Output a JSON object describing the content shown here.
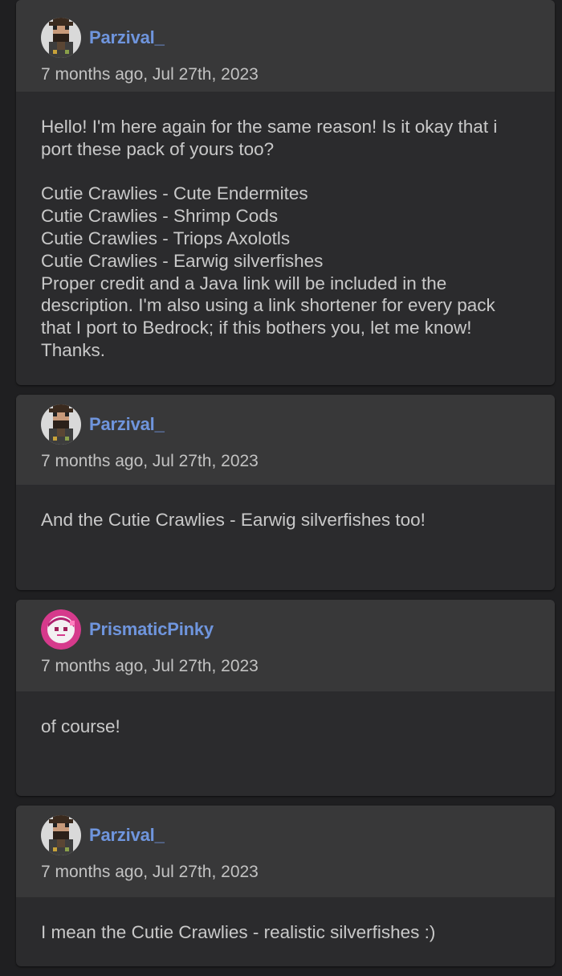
{
  "comments": [
    {
      "author": "Parzival_",
      "avatar_icon": "pixel-bearded-man-avatar-icon",
      "timestamp": "7 months ago, Jul 27th, 2023",
      "body": "Hello! I'm here again for the same reason! Is it okay that i port these pack of yours too?\n\nCutie Crawlies - Cute Endermites\nCutie Crawlies - Shrimp Cods\nCutie Crawlies - Triops Axolotls\nCutie Crawlies - Earwig silverfishes\nProper credit and a Java link will be included in the description. I'm also using a link shortener for every pack that I port to Bedrock; if this bothers you, let me know! Thanks."
    },
    {
      "author": "Parzival_",
      "avatar_icon": "pixel-bearded-man-avatar-icon",
      "timestamp": "7 months ago, Jul 27th, 2023",
      "body": "And the Cutie Crawlies - Earwig silverfishes too!"
    },
    {
      "author": "PrismaticPinky",
      "avatar_icon": "pink-character-avatar-icon",
      "timestamp": "7 months ago, Jul 27th, 2023",
      "body": "of course!"
    },
    {
      "author": "Parzival_",
      "avatar_icon": "pixel-bearded-man-avatar-icon",
      "timestamp": "7 months ago, Jul 27th, 2023",
      "body": "I mean the Cutie Crawlies - realistic silverfishes :)"
    }
  ],
  "colors": {
    "page_background": "#1f1f21",
    "card_background": "#2b2b2d",
    "card_header": "#383839",
    "username": "#6f95dd",
    "text": "#c9c9c9"
  }
}
